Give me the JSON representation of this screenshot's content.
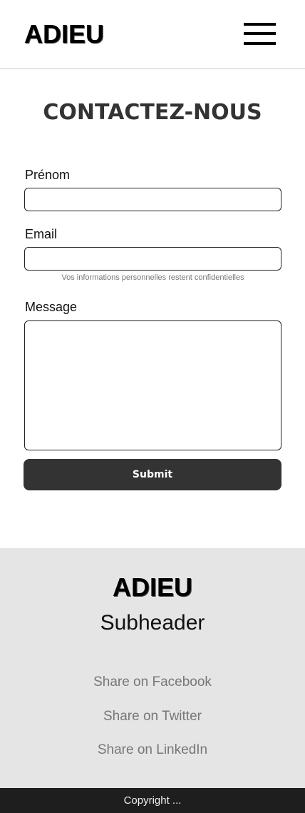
{
  "header": {
    "logo": "ADIEU",
    "menu_icon": "hamburger-menu-icon"
  },
  "main": {
    "title": "CONTACTEZ-NOUS",
    "form": {
      "firstname_label": "Prénom",
      "firstname_value": "",
      "email_label": "Email",
      "email_value": "",
      "email_hint": "Vos informations personnelles restent confidentielles",
      "message_label": "Message",
      "message_value": "",
      "submit_label": "Submit"
    }
  },
  "footer": {
    "logo": "ADIEU",
    "subheader": "Subheader",
    "links": [
      "Share on Facebook",
      "Share on Twitter",
      "Share on LinkedIn"
    ],
    "copyright": "Copyright ..."
  },
  "colors": {
    "button_bg": "#333333",
    "footer_bg": "#e5e5e5",
    "copyright_bg": "#1e1e1e",
    "link_text": "#777777"
  }
}
